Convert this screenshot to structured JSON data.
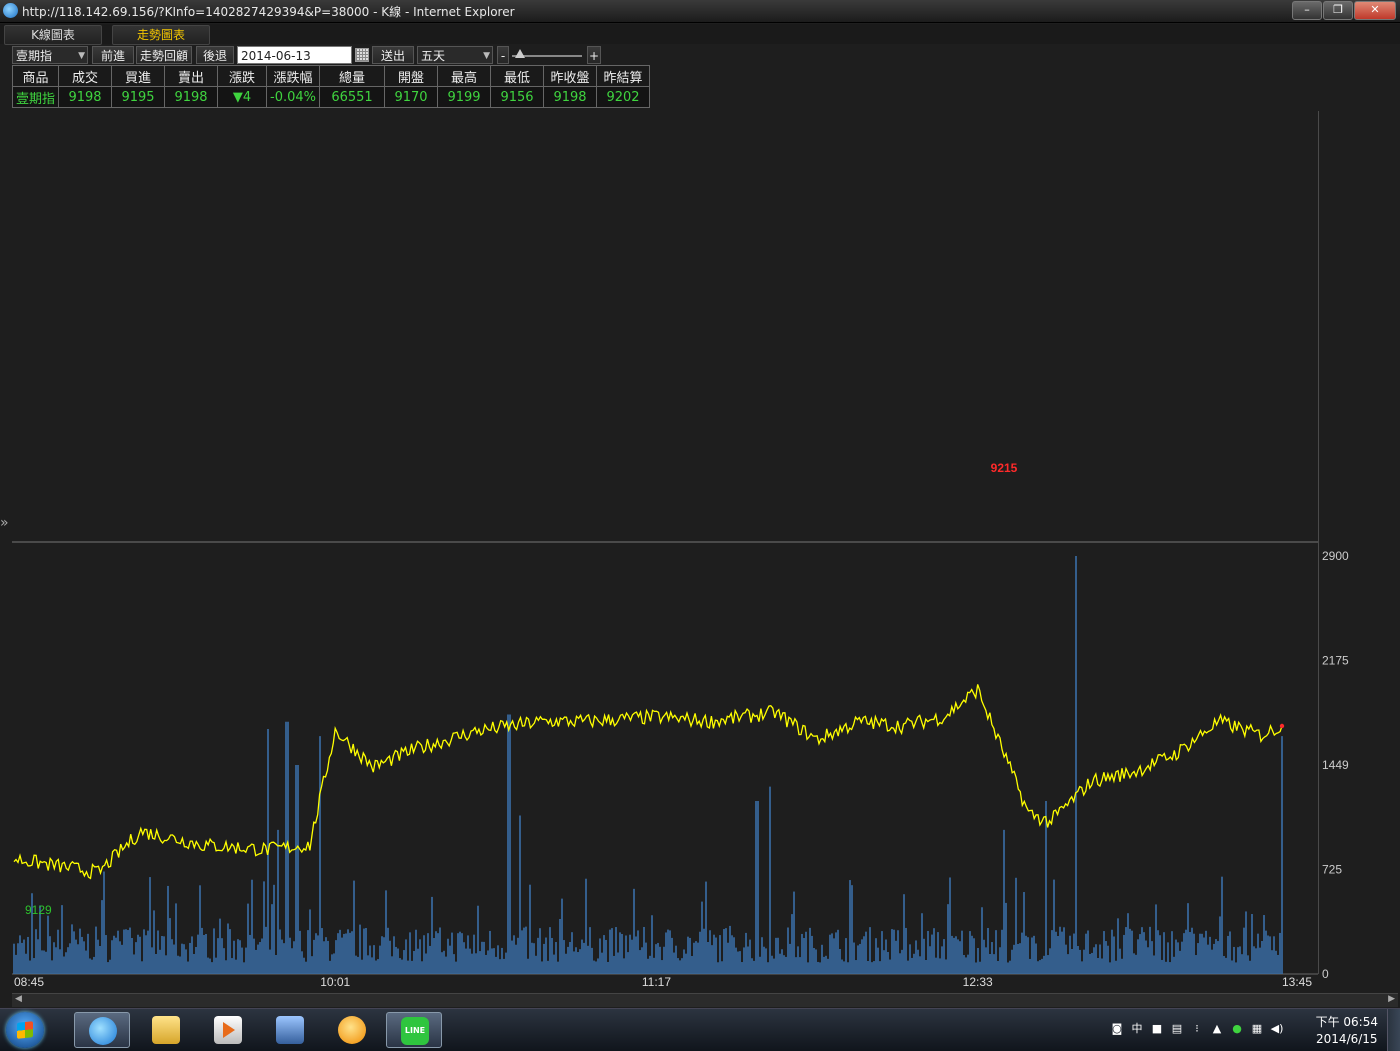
{
  "window": {
    "title": "http://118.142.69.156/?KInfo=1402827429394&P=38000 - K線 - Internet Explorer",
    "min": "–",
    "max": "❐",
    "close": "✕"
  },
  "tabs": [
    {
      "label": "K線圖表",
      "active": false
    },
    {
      "label": "走勢圖表",
      "active": true
    }
  ],
  "toolbar": {
    "product": "壹期指",
    "forward": "前進",
    "trend_review": "走勢回顧",
    "back": "後退",
    "date": "2014-06-13",
    "submit": "送出",
    "period": "五天",
    "zoom_out": "-",
    "zoom_in": "+",
    "zoom_level": 0.05
  },
  "quote_table": {
    "headers": [
      "商品",
      "成交",
      "買進",
      "賣出",
      "漲跌",
      "漲跌幅",
      "總量",
      "開盤",
      "最高",
      "最低",
      "昨收盤",
      "昨結算"
    ],
    "values": [
      "壹期指",
      "9198",
      "9195",
      "9198",
      "4",
      "-0.04%",
      "66551",
      "9170",
      "9199",
      "9156",
      "9198",
      "9202"
    ],
    "change_direction": "down"
  },
  "chart_data": {
    "type": "line",
    "price_series": {
      "x": [
        "08:45",
        "09:05",
        "09:15",
        "09:30",
        "09:45",
        "09:55",
        "10:01",
        "10:10",
        "10:20",
        "10:35",
        "10:50",
        "11:00",
        "11:17",
        "11:30",
        "11:45",
        "11:55",
        "12:00",
        "12:05",
        "12:15",
        "12:25",
        "12:33",
        "12:45",
        "12:50",
        "13:00",
        "13:10",
        "13:20",
        "13:30",
        "13:40",
        "13:45"
      ],
      "values": [
        9134,
        9131,
        9140,
        9137,
        9136,
        9137,
        9162,
        9154,
        9158,
        9162,
        9164,
        9164,
        9165,
        9164,
        9166,
        9160,
        9162,
        9164,
        9163,
        9165,
        9171,
        9144,
        9142,
        9151,
        9153,
        9157,
        9164,
        9161,
        9163
      ]
    },
    "annotations": {
      "high_label": "9215",
      "low_label": "9129"
    },
    "price_ylim": [
      9125,
      9220
    ],
    "volume_axis_ticks": [
      "2900",
      "2175",
      "1449",
      "725",
      "0"
    ],
    "volume_ylim": [
      0,
      2900
    ],
    "x_ticks": [
      "08:45",
      "10:01",
      "11:17",
      "12:33",
      "13:45"
    ],
    "colors": {
      "price_line": "#ffff00",
      "volume_bars": "#3a6fa8",
      "high_label": "#ff2a2a",
      "low_label": "#2dc22d",
      "last_point": "#ff2a2a"
    }
  },
  "taskbar": {
    "ime": "中",
    "clock_time": "下午 06:54",
    "clock_date": "2014/6/15",
    "line_label": "LINE"
  }
}
